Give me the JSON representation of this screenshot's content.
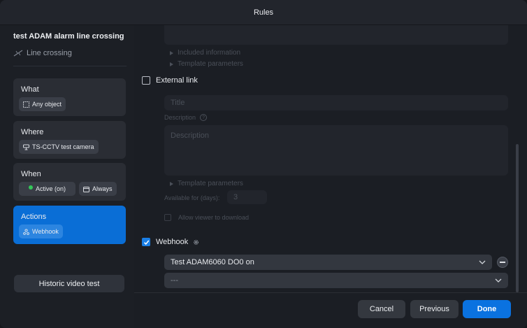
{
  "window": {
    "title": "Rules"
  },
  "sidebar": {
    "rule_name": "test ADAM alarm line crossing",
    "rule_type": "Line crossing",
    "steps": [
      {
        "label": "What",
        "chips": [
          {
            "label": "Any object",
            "icon": "bounding-box-icon"
          }
        ]
      },
      {
        "label": "Where",
        "chips": [
          {
            "label": "TS-CCTV test camera",
            "icon": "camera-icon"
          }
        ]
      },
      {
        "label": "When",
        "chips": [
          {
            "label": "Active (on)",
            "icon": "status-dot-icon"
          },
          {
            "label": "Always",
            "icon": "calendar-icon"
          }
        ]
      },
      {
        "label": "Actions",
        "chips": [
          {
            "label": "Webhook",
            "icon": "webhook-icon"
          }
        ],
        "active": true
      }
    ],
    "historic_button": "Historic video test"
  },
  "main": {
    "included_information": "Included information",
    "template_parameters": "Template parameters",
    "external_link": {
      "label": "External link",
      "checked": false,
      "title_placeholder": "Title",
      "description_label": "Description",
      "description_placeholder": "Description",
      "template_parameters": "Template parameters",
      "available_for_label": "Available for (days):",
      "available_for_value": "3",
      "allow_download_label": "Allow viewer to download"
    },
    "webhook": {
      "label": "Webhook",
      "checked": true,
      "selected": "Test ADAM6060 DO0 on",
      "empty_option": "---"
    }
  },
  "footer": {
    "cancel": "Cancel",
    "previous": "Previous",
    "done": "Done"
  },
  "colors": {
    "accent": "#0a72e0",
    "active_step": "#0a6ed6",
    "active_dot": "#34c759"
  }
}
